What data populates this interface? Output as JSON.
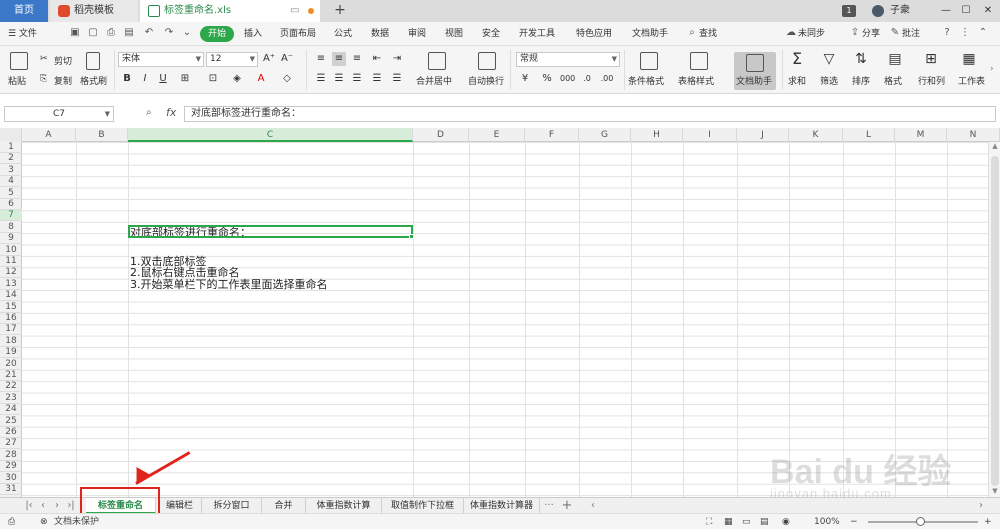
{
  "titlebar": {
    "home_tab": "首页",
    "template_tab": "稻壳模板",
    "file_tab": "标签重命名.xls",
    "page_badge": "1",
    "username": "子衆",
    "min": "—",
    "max": "☐",
    "close": "✕"
  },
  "menubar": {
    "file": "☰ 文件",
    "start": "开始",
    "items": [
      "插入",
      "页面布局",
      "公式",
      "数据",
      "审阅",
      "视图",
      "安全",
      "开发工具",
      "特色应用",
      "文档助手"
    ],
    "search": "查找",
    "sync": "未同步",
    "share": "分享",
    "comment": "批注"
  },
  "ribbon": {
    "paste": "粘贴",
    "cut": "剪切",
    "copy": "复制",
    "format_painter": "格式刷",
    "font_name": "宋体",
    "font_size": "12",
    "merge_center": "合并居中",
    "wrap": "自动换行",
    "number_format": "常规",
    "cond_format": "条件格式",
    "table_style": "表格样式",
    "doc_helper": "文档助手",
    "sum": "求和",
    "filter": "筛选",
    "sort": "排序",
    "format": "格式",
    "row_col": "行和列",
    "sheet": "工作表"
  },
  "formulabar": {
    "cell_ref": "C7",
    "fx": "fx",
    "value": "对底部标签进行重命名："
  },
  "columns": [
    "A",
    "B",
    "C",
    "D",
    "E",
    "F",
    "G",
    "H",
    "I",
    "J",
    "K",
    "L",
    "M",
    "N"
  ],
  "rows": [
    "1",
    "2",
    "3",
    "4",
    "5",
    "6",
    "7",
    "8",
    "9",
    "10",
    "11",
    "12",
    "13",
    "14",
    "15",
    "16",
    "17",
    "18",
    "19",
    "20",
    "21",
    "22",
    "23",
    "24",
    "25",
    "26",
    "27",
    "28",
    "29",
    "30",
    "31"
  ],
  "cells": {
    "c7": "对底部标签进行重命名：",
    "c9": "1.双击底部标签",
    "c10": "2.鼠标右键点击重命名",
    "c11": "3.开始菜单栏下的工作表里面选择重命名"
  },
  "sheets": [
    "标签重命名",
    "编辑栏",
    "拆分窗口",
    "合并",
    "体重指数计算",
    "取值制作下拉框",
    "体重指数计算器"
  ],
  "statusbar": {
    "protect": "文档未保护",
    "zoom": "100%"
  },
  "watermark": {
    "brand": "Bai du 经验",
    "url": "jingyan.baidu.com"
  },
  "colors": {
    "accent_green": "#2ca84a",
    "highlight_red": "#e0241b",
    "home_blue": "#3c78c8"
  }
}
